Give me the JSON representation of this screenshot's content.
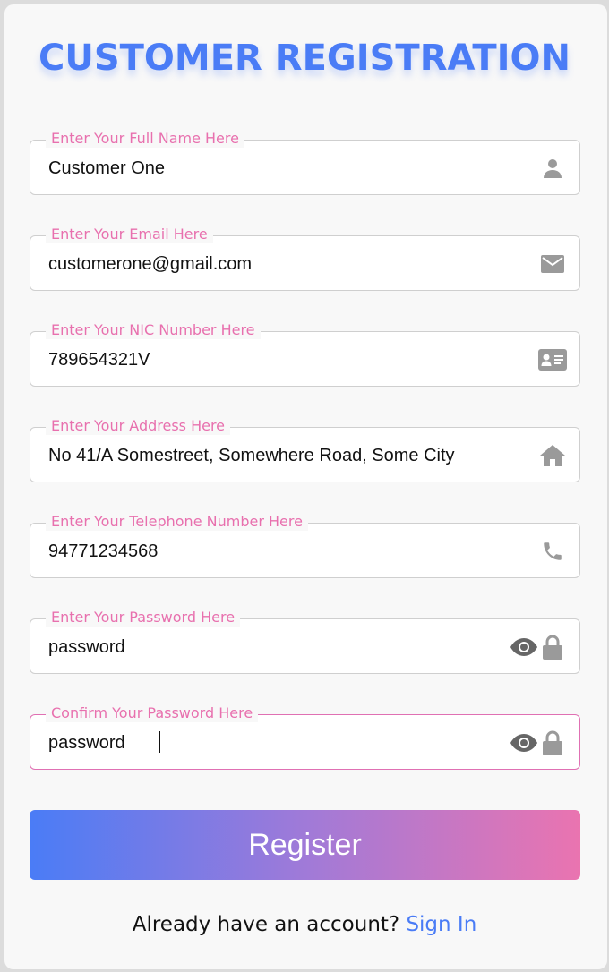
{
  "title": "CUSTOMER REGISTRATION",
  "fields": [
    {
      "label": "Enter Your Full Name Here",
      "value": "Customer One",
      "icon": "user-icon"
    },
    {
      "label": "Enter Your Email Here",
      "value": "customerone@gmail.com",
      "icon": "envelope-icon"
    },
    {
      "label": "Enter Your NIC Number Here",
      "value": "789654321V",
      "icon": "id-card-icon"
    },
    {
      "label": "Enter Your Address Here",
      "value": "No 41/A Somestreet, Somewhere Road, Some City",
      "icon": "home-icon"
    },
    {
      "label": "Enter Your Telephone Number Here",
      "value": "94771234568",
      "icon": "phone-icon"
    },
    {
      "label": "Enter Your Password Here",
      "value": "password",
      "icon": "lock-icon"
    },
    {
      "label": "Confirm Your Password Here",
      "value": "password",
      "icon": "lock-icon"
    }
  ],
  "register_label": "Register",
  "signin": {
    "prompt": "Already have an account?",
    "link": "Sign In"
  },
  "colors": {
    "accent_blue": "#4a7cf6",
    "accent_pink": "#e870ae",
    "icon_gray": "#9a9a9a"
  }
}
